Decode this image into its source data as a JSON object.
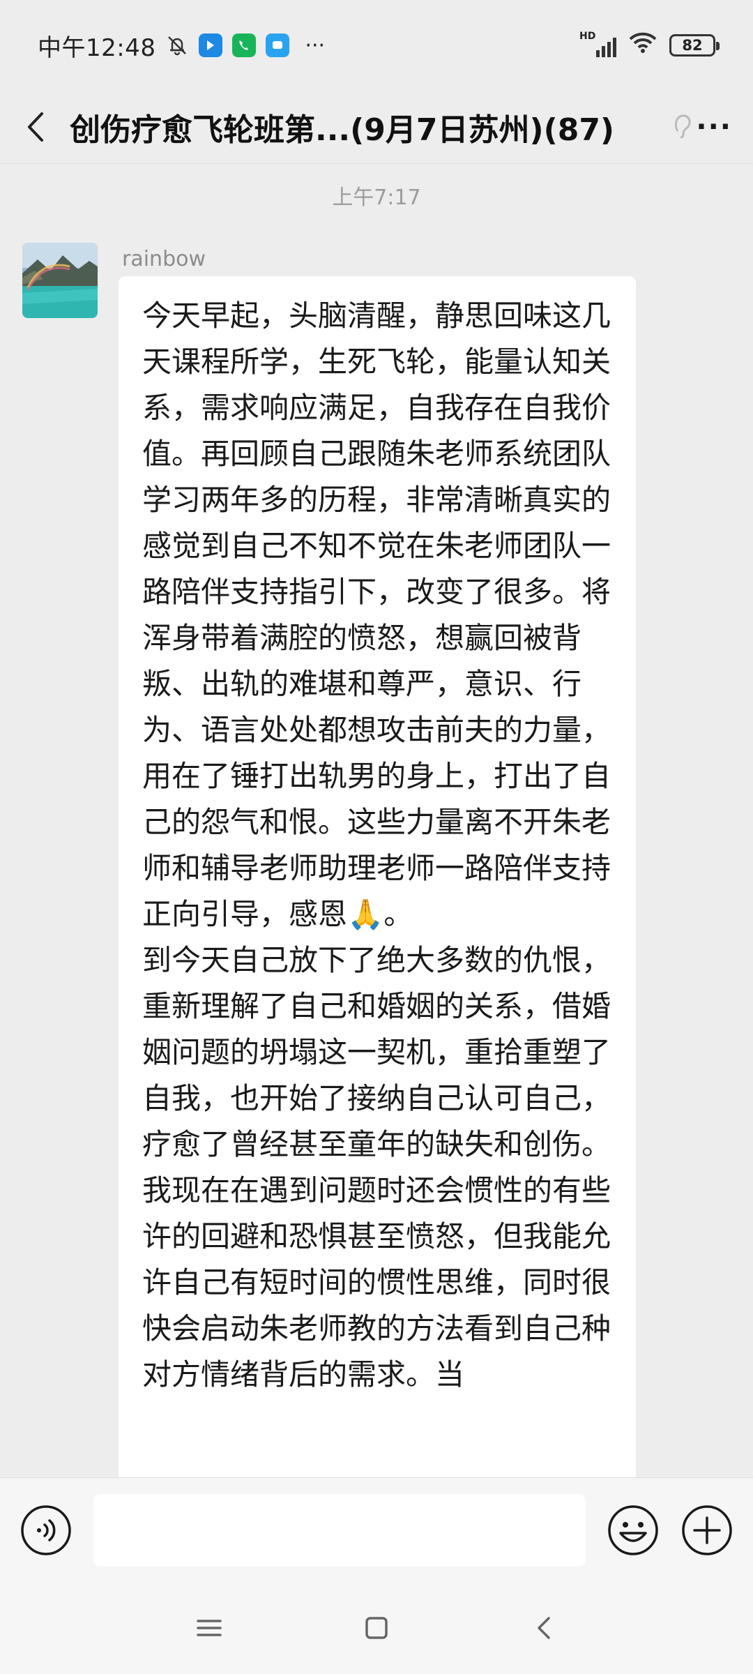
{
  "status_bar": {
    "time": "中午12:48",
    "more": "···",
    "battery": "82",
    "network": "HD"
  },
  "header": {
    "title": "创伤疗愈飞轮班第...(9月7日苏州)(87)",
    "more_label": "···"
  },
  "chat": {
    "timestamp": "上午7:17",
    "message": {
      "sender": "rainbow",
      "text": "今天早起，头脑清醒，静思回味这几天课程所学，生死飞轮，能量认知关系，需求响应满足，自我存在自我价值。再回顾自己跟随朱老师系统团队学习两年多的历程，非常清晰真实的感觉到自己不知不觉在朱老师团队一路陪伴支持指引下，改变了很多。将浑身带着满腔的愤怒，想赢回被背叛、出轨的难堪和尊严，意识、行为、语言处处都想攻击前夫的力量，用在了锤打出轨男的身上，打出了自己的怨气和恨。这些力量离不开朱老师和辅导老师助理老师一路陪伴支持正向引导，感恩🙏。\n到今天自己放下了绝大多数的仇恨，重新理解了自己和婚姻的关系，借婚姻问题的坍塌这一契机，重拾重塑了自我，也开始了接纳自己认可自己，疗愈了曾经甚至童年的缺失和创伤。\n我现在在遇到问题时还会惯性的有些许的回避和恐惧甚至愤怒，但我能允许自己有短时间的惯性思维，同时很快会启动朱老师教的方法看到自己种对方情绪背后的需求。当"
    }
  },
  "input_bar": {
    "voice_icon": "voice-icon",
    "emoji_icon": "emoji-icon",
    "plus_icon": "plus-icon",
    "value": ""
  },
  "nav_bar": {
    "menu_icon": "menu-icon",
    "home_icon": "home-icon",
    "back_icon": "back-icon"
  },
  "colors": {
    "background": "#ededed",
    "bubble": "#ffffff",
    "bar": "#f6f6f6"
  }
}
